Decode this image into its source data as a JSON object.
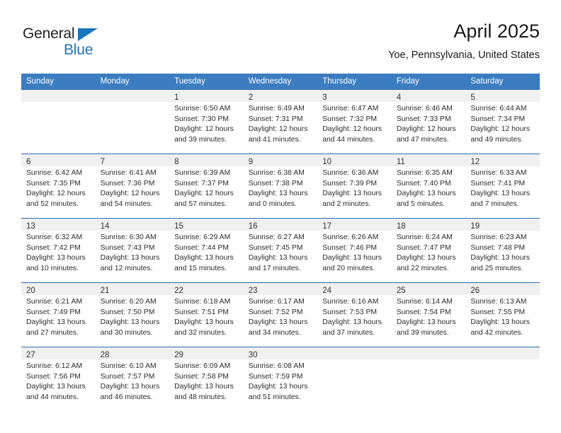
{
  "logo": {
    "word_top": "General",
    "word_bottom": "Blue",
    "triangle_color": "#1b75bc",
    "top_color": "#231f20"
  },
  "header": {
    "title": "April 2025",
    "subtitle": "Yoe, Pennsylvania, United States"
  },
  "theme": {
    "header_blue": "#3b7dc0",
    "rule_blue": "#2b6cad",
    "daynum_band": "#f0f0f0",
    "text": "#2b2b2b"
  },
  "weekdays": [
    "Sunday",
    "Monday",
    "Tuesday",
    "Wednesday",
    "Thursday",
    "Friday",
    "Saturday"
  ],
  "weeks": [
    [
      {
        "day": "",
        "sunrise": "",
        "sunset": "",
        "daylight_1": "",
        "daylight_2": ""
      },
      {
        "day": "",
        "sunrise": "",
        "sunset": "",
        "daylight_1": "",
        "daylight_2": ""
      },
      {
        "day": "1",
        "sunrise": "Sunrise: 6:50 AM",
        "sunset": "Sunset: 7:30 PM",
        "daylight_1": "Daylight: 12 hours",
        "daylight_2": "and 39 minutes."
      },
      {
        "day": "2",
        "sunrise": "Sunrise: 6:49 AM",
        "sunset": "Sunset: 7:31 PM",
        "daylight_1": "Daylight: 12 hours",
        "daylight_2": "and 41 minutes."
      },
      {
        "day": "3",
        "sunrise": "Sunrise: 6:47 AM",
        "sunset": "Sunset: 7:32 PM",
        "daylight_1": "Daylight: 12 hours",
        "daylight_2": "and 44 minutes."
      },
      {
        "day": "4",
        "sunrise": "Sunrise: 6:46 AM",
        "sunset": "Sunset: 7:33 PM",
        "daylight_1": "Daylight: 12 hours",
        "daylight_2": "and 47 minutes."
      },
      {
        "day": "5",
        "sunrise": "Sunrise: 6:44 AM",
        "sunset": "Sunset: 7:34 PM",
        "daylight_1": "Daylight: 12 hours",
        "daylight_2": "and 49 minutes."
      }
    ],
    [
      {
        "day": "6",
        "sunrise": "Sunrise: 6:42 AM",
        "sunset": "Sunset: 7:35 PM",
        "daylight_1": "Daylight: 12 hours",
        "daylight_2": "and 52 minutes."
      },
      {
        "day": "7",
        "sunrise": "Sunrise: 6:41 AM",
        "sunset": "Sunset: 7:36 PM",
        "daylight_1": "Daylight: 12 hours",
        "daylight_2": "and 54 minutes."
      },
      {
        "day": "8",
        "sunrise": "Sunrise: 6:39 AM",
        "sunset": "Sunset: 7:37 PM",
        "daylight_1": "Daylight: 12 hours",
        "daylight_2": "and 57 minutes."
      },
      {
        "day": "9",
        "sunrise": "Sunrise: 6:38 AM",
        "sunset": "Sunset: 7:38 PM",
        "daylight_1": "Daylight: 13 hours",
        "daylight_2": "and 0 minutes."
      },
      {
        "day": "10",
        "sunrise": "Sunrise: 6:36 AM",
        "sunset": "Sunset: 7:39 PM",
        "daylight_1": "Daylight: 13 hours",
        "daylight_2": "and 2 minutes."
      },
      {
        "day": "11",
        "sunrise": "Sunrise: 6:35 AM",
        "sunset": "Sunset: 7:40 PM",
        "daylight_1": "Daylight: 13 hours",
        "daylight_2": "and 5 minutes."
      },
      {
        "day": "12",
        "sunrise": "Sunrise: 6:33 AM",
        "sunset": "Sunset: 7:41 PM",
        "daylight_1": "Daylight: 13 hours",
        "daylight_2": "and 7 minutes."
      }
    ],
    [
      {
        "day": "13",
        "sunrise": "Sunrise: 6:32 AM",
        "sunset": "Sunset: 7:42 PM",
        "daylight_1": "Daylight: 13 hours",
        "daylight_2": "and 10 minutes."
      },
      {
        "day": "14",
        "sunrise": "Sunrise: 6:30 AM",
        "sunset": "Sunset: 7:43 PM",
        "daylight_1": "Daylight: 13 hours",
        "daylight_2": "and 12 minutes."
      },
      {
        "day": "15",
        "sunrise": "Sunrise: 6:29 AM",
        "sunset": "Sunset: 7:44 PM",
        "daylight_1": "Daylight: 13 hours",
        "daylight_2": "and 15 minutes."
      },
      {
        "day": "16",
        "sunrise": "Sunrise: 6:27 AM",
        "sunset": "Sunset: 7:45 PM",
        "daylight_1": "Daylight: 13 hours",
        "daylight_2": "and 17 minutes."
      },
      {
        "day": "17",
        "sunrise": "Sunrise: 6:26 AM",
        "sunset": "Sunset: 7:46 PM",
        "daylight_1": "Daylight: 13 hours",
        "daylight_2": "and 20 minutes."
      },
      {
        "day": "18",
        "sunrise": "Sunrise: 6:24 AM",
        "sunset": "Sunset: 7:47 PM",
        "daylight_1": "Daylight: 13 hours",
        "daylight_2": "and 22 minutes."
      },
      {
        "day": "19",
        "sunrise": "Sunrise: 6:23 AM",
        "sunset": "Sunset: 7:48 PM",
        "daylight_1": "Daylight: 13 hours",
        "daylight_2": "and 25 minutes."
      }
    ],
    [
      {
        "day": "20",
        "sunrise": "Sunrise: 6:21 AM",
        "sunset": "Sunset: 7:49 PM",
        "daylight_1": "Daylight: 13 hours",
        "daylight_2": "and 27 minutes."
      },
      {
        "day": "21",
        "sunrise": "Sunrise: 6:20 AM",
        "sunset": "Sunset: 7:50 PM",
        "daylight_1": "Daylight: 13 hours",
        "daylight_2": "and 30 minutes."
      },
      {
        "day": "22",
        "sunrise": "Sunrise: 6:18 AM",
        "sunset": "Sunset: 7:51 PM",
        "daylight_1": "Daylight: 13 hours",
        "daylight_2": "and 32 minutes."
      },
      {
        "day": "23",
        "sunrise": "Sunrise: 6:17 AM",
        "sunset": "Sunset: 7:52 PM",
        "daylight_1": "Daylight: 13 hours",
        "daylight_2": "and 34 minutes."
      },
      {
        "day": "24",
        "sunrise": "Sunrise: 6:16 AM",
        "sunset": "Sunset: 7:53 PM",
        "daylight_1": "Daylight: 13 hours",
        "daylight_2": "and 37 minutes."
      },
      {
        "day": "25",
        "sunrise": "Sunrise: 6:14 AM",
        "sunset": "Sunset: 7:54 PM",
        "daylight_1": "Daylight: 13 hours",
        "daylight_2": "and 39 minutes."
      },
      {
        "day": "26",
        "sunrise": "Sunrise: 6:13 AM",
        "sunset": "Sunset: 7:55 PM",
        "daylight_1": "Daylight: 13 hours",
        "daylight_2": "and 42 minutes."
      }
    ],
    [
      {
        "day": "27",
        "sunrise": "Sunrise: 6:12 AM",
        "sunset": "Sunset: 7:56 PM",
        "daylight_1": "Daylight: 13 hours",
        "daylight_2": "and 44 minutes."
      },
      {
        "day": "28",
        "sunrise": "Sunrise: 6:10 AM",
        "sunset": "Sunset: 7:57 PM",
        "daylight_1": "Daylight: 13 hours",
        "daylight_2": "and 46 minutes."
      },
      {
        "day": "29",
        "sunrise": "Sunrise: 6:09 AM",
        "sunset": "Sunset: 7:58 PM",
        "daylight_1": "Daylight: 13 hours",
        "daylight_2": "and 48 minutes."
      },
      {
        "day": "30",
        "sunrise": "Sunrise: 6:08 AM",
        "sunset": "Sunset: 7:59 PM",
        "daylight_1": "Daylight: 13 hours",
        "daylight_2": "and 51 minutes."
      },
      {
        "day": "",
        "sunrise": "",
        "sunset": "",
        "daylight_1": "",
        "daylight_2": ""
      },
      {
        "day": "",
        "sunrise": "",
        "sunset": "",
        "daylight_1": "",
        "daylight_2": ""
      },
      {
        "day": "",
        "sunrise": "",
        "sunset": "",
        "daylight_1": "",
        "daylight_2": ""
      }
    ]
  ]
}
